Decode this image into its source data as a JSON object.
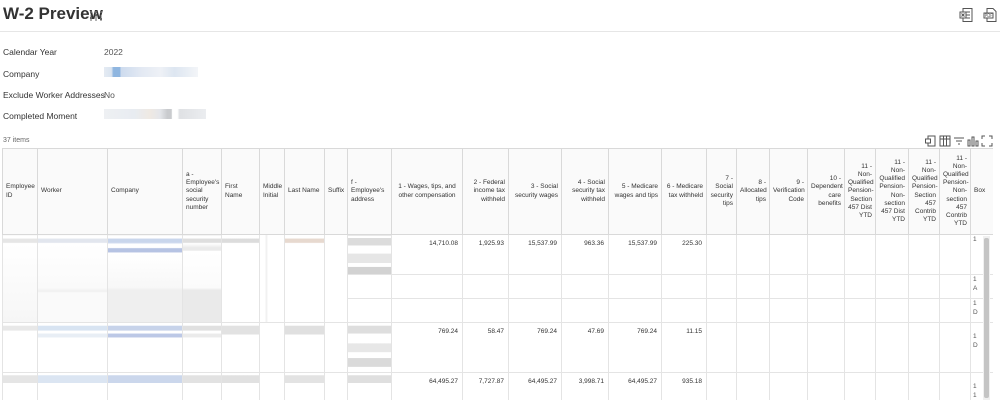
{
  "page": {
    "title": "W-2 Preview"
  },
  "fields": {
    "calendar_year_label": "Calendar Year",
    "calendar_year_value": "2022",
    "company_label": "Company",
    "exclude_label": "Exclude Worker Addresses",
    "exclude_value": "No",
    "completed_label": "Completed Moment"
  },
  "table": {
    "items_count": "37 items",
    "columns": [
      "Employee ID",
      "Worker",
      "Company",
      "a - Employee's social security number",
      "First Name",
      "Middle Initial",
      "Last Name",
      "Suffix",
      "f - Employee's address",
      "1 - Wages, tips, and other compensation",
      "2 - Federal income tax withheld",
      "3 - Social security wages",
      "4 - Social security tax withheld",
      "5 - Medicare wages and tips",
      "6 - Medicare tax withheld",
      "7 - Social security tips",
      "8 - Allocated tips",
      "9 - Verification Code",
      "10 - Dependent care benefits",
      "11 - Non-Qualified Pension-Section 457 Dist YTD",
      "11 - Non-Qualified Pension-Non-section 457 Dist YTD",
      "11 - Non-Qualified Pension-Section 457 Contrib YTD",
      "11 - Non-Qualified Pension-Non-section 457 Contrib YTD",
      "Box"
    ],
    "rows": [
      {
        "box1": "14,710.08",
        "box2": "1,925.93",
        "box3": "15,537.99",
        "box4": "963.36",
        "box5": "15,537.99",
        "box6": "225.30"
      },
      {
        "box1": "769.24",
        "box2": "58.47",
        "box3": "769.24",
        "box4": "47.69",
        "box5": "769.24",
        "box6": "11.15"
      },
      {
        "box1": "64,495.27",
        "box2": "7,727.87",
        "box3": "64,495.27",
        "box4": "3,998.71",
        "box5": "64,495.27",
        "box6": "935.18"
      }
    ],
    "cut_column": {
      "row1": [
        "1",
        "1",
        "A",
        "1",
        "D"
      ],
      "row2": [
        "1",
        "D"
      ],
      "row3": [
        "1",
        "1"
      ]
    }
  },
  "icons": {
    "related_actions": "related-actions-icon",
    "export_excel": "export-excel-icon",
    "export_pdf": "export-pdf-icon",
    "table_excel": "table-export-excel-icon",
    "table_columns": "table-columns-icon",
    "table_filter": "table-filter-icon",
    "table_chart": "table-chart-icon",
    "table_fullscreen": "table-fullscreen-icon"
  },
  "colors": {
    "border": "#d9d9d9",
    "header_bg": "#fafafa",
    "redaction_blue": "#b9cbe6",
    "redaction_gray": "#e3e3e3"
  }
}
